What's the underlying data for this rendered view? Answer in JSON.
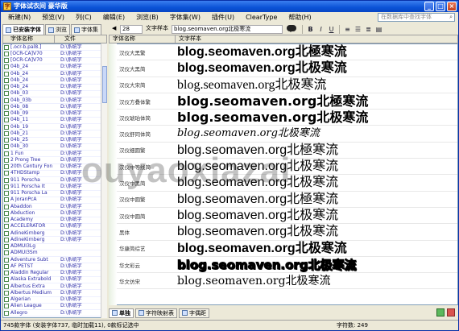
{
  "window": {
    "title": "字体试衣间 豪华版"
  },
  "menu": [
    {
      "label": "新建(N)"
    },
    {
      "label": "预览(V)"
    },
    {
      "label": "列(C)"
    },
    {
      "label": "编辑(E)"
    },
    {
      "label": "浏览(B)"
    },
    {
      "label": "字体集(W)"
    },
    {
      "label": "插件(U)"
    },
    {
      "label": "ClearType"
    },
    {
      "label": "帮助(H)"
    }
  ],
  "search": {
    "placeholder": "在数据库中查找字体"
  },
  "left_tabs": [
    {
      "label": "已安装字体"
    },
    {
      "label": "浏览"
    },
    {
      "label": "字体集"
    }
  ],
  "left_columns": {
    "name": "字体名称",
    "file": "文件"
  },
  "left_rows": [
    {
      "name": "[.ocr-b.pal8.]",
      "path": "D:\\系统字"
    },
    {
      "name": "[OCR-CA]V70",
      "path": "D:\\系统字"
    },
    {
      "name": "[OCR-CA]V70",
      "path": "D:\\系统字"
    },
    {
      "name": "04b_24",
      "path": "D:\\系统字"
    },
    {
      "name": "04b_24",
      "path": "D:\\系统字"
    },
    {
      "name": "04b_24",
      "path": "D:\\系统字"
    },
    {
      "name": "04b_24",
      "path": "D:\\系统字"
    },
    {
      "name": "04b_03",
      "path": "D:\\系统字"
    },
    {
      "name": "04b_03b",
      "path": "D:\\系统字"
    },
    {
      "name": "04b_08",
      "path": "D:\\系统字"
    },
    {
      "name": "04b_09",
      "path": "D:\\系统字"
    },
    {
      "name": "04b_11",
      "path": "D:\\系统字"
    },
    {
      "name": "04b_19",
      "path": "D:\\系统字"
    },
    {
      "name": "04b_21",
      "path": "D:\\系统字"
    },
    {
      "name": "04b_25",
      "path": "D:\\系统字"
    },
    {
      "name": "04b_30",
      "path": "D:\\系统字"
    },
    {
      "name": "1 Fun",
      "path": "D:\\系统字"
    },
    {
      "name": "2 Prong Tree",
      "path": "D:\\系统字"
    },
    {
      "name": "20th Century Font",
      "path": "D:\\系统字"
    },
    {
      "name": "4THDStamp",
      "path": "D:\\系统字"
    },
    {
      "name": "911 Porscha",
      "path": "D:\\系统字"
    },
    {
      "name": "911 Porscha It",
      "path": "D:\\系统字"
    },
    {
      "name": "911 Porscha La",
      "path": "D:\\系统字"
    },
    {
      "name": "A JoranPcA",
      "path": "D:\\系统字"
    },
    {
      "name": "Abaddon",
      "path": "D:\\系统字"
    },
    {
      "name": "Abduction",
      "path": "D:\\系统字"
    },
    {
      "name": "Academy",
      "path": "D:\\系统字"
    },
    {
      "name": "ACCELERATOR",
      "path": "D:\\系统字"
    },
    {
      "name": "AdineKirnberg",
      "path": "D:\\系统字"
    },
    {
      "name": "AdineKirnberg",
      "path": "D:\\系统字"
    },
    {
      "name": "ADMUI3Lg",
      "path": ""
    },
    {
      "name": "ADMUI3Sm",
      "path": ""
    },
    {
      "name": "Adventure Subt",
      "path": "D:\\系统字"
    },
    {
      "name": "AF PETST",
      "path": "D:\\系统字"
    },
    {
      "name": "Aladdin Regular",
      "path": "D:\\系统字"
    },
    {
      "name": "Alaska Extrabold",
      "path": "D:\\系统字"
    },
    {
      "name": "Albertus Extra",
      "path": "D:\\系统字"
    },
    {
      "name": "Albertus Medium",
      "path": "D:\\系统字"
    },
    {
      "name": "Algerian",
      "path": "D:\\系统字"
    },
    {
      "name": "Alien League",
      "path": "D:\\系统字"
    },
    {
      "name": "Allegro",
      "path": "D:\\系统字"
    }
  ],
  "toolbar": {
    "size": "28",
    "sample_label": "文字样本",
    "sample_text": "blog.seomaven.org北极寒流",
    "bold": "B",
    "italic": "I",
    "underline": "U"
  },
  "grid_columns": {
    "name": "字体名称",
    "sample": "文字样本"
  },
  "grid_rows": [
    {
      "font": "汉仪大黑繁",
      "sample": "blog.seomaven.org北極寒流",
      "style": "s-arialb"
    },
    {
      "font": "汉仪大黑简",
      "sample": "blog.seomaven.org北极寒流",
      "style": "s-arialb"
    },
    {
      "font": "汉仪大宋简",
      "sample": "blog.seomaven.org北极寒流",
      "style": "s-serif"
    },
    {
      "font": "汉仪方叠体繁",
      "sample": "blog.seomaven.org北極寒流",
      "style": "s-heavy"
    },
    {
      "font": "汉仪琥珀体简",
      "sample": "blog.seomaven.org北极寒流",
      "style": "s-heavy"
    },
    {
      "font": "汉仪舒同体简",
      "sample": "blog.seomaven.org北极寒流",
      "style": "s-script"
    },
    {
      "font": "汉仪细圆繁",
      "sample": "blog.seomaven.org北極寒流",
      "style": "s-light"
    },
    {
      "font": "汉仪中等线简",
      "sample": "blog.seomaven.org北极寒流",
      "style": "s-light"
    },
    {
      "font": "汉仪中黑简",
      "sample": "blog.seomaven.org北极寒流",
      "style": "s-arial"
    },
    {
      "font": "汉仪中圆繁",
      "sample": "blog.seomaven.org北極寒流",
      "style": "s-arial"
    },
    {
      "font": "汉仪中圆简",
      "sample": "blog.seomaven.org北极寒流",
      "style": "s-arial"
    },
    {
      "font": "黑体",
      "sample": "blog.seomaven.org北极寒流",
      "style": "s-arial"
    },
    {
      "font": "华康简综艺",
      "sample": "blog.seomaven.org北极寒流",
      "style": "s-arialb"
    },
    {
      "font": "华文彩云",
      "sample": "blog.seomaven.org北极寒流",
      "style": "s-outline"
    },
    {
      "font": "华文仿宋",
      "sample": "blog.seomaven.org北极寒流",
      "style": "s-small"
    }
  ],
  "bottom_tabs": [
    {
      "label": "单独"
    },
    {
      "label": "字符映射表"
    },
    {
      "label": "字偶距"
    }
  ],
  "status": {
    "left": "745款字体 (安装字体737, 临时加载11), 0款标记选中",
    "right": "字符数: 249"
  },
  "watermark": "ouyaoxiazai"
}
